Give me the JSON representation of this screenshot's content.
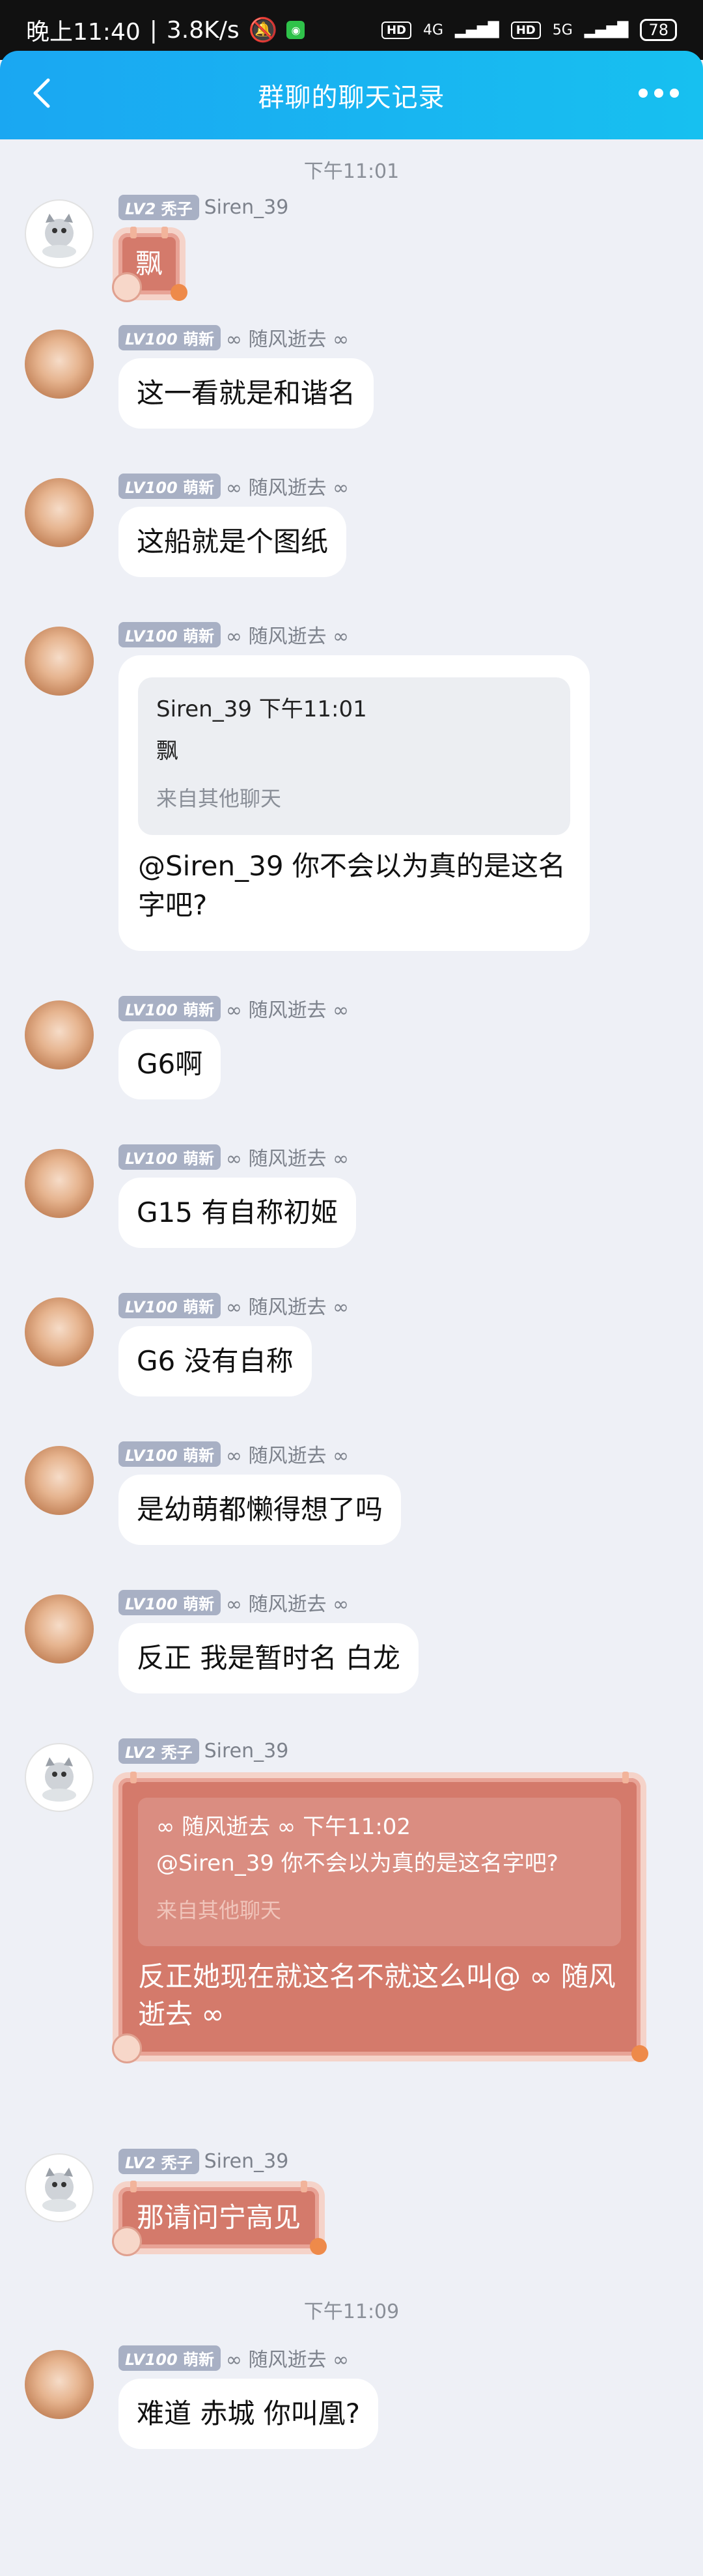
{
  "status": {
    "time": "晚上11:40",
    "speed": "3.8K/s",
    "network1": "4G",
    "network2": "5G",
    "hd": "HD",
    "battery": "78"
  },
  "appbar": {
    "title": "群聊的聊天记录"
  },
  "chat": {
    "time1": "下午11:01",
    "time2": "下午11:09",
    "lv2": "LV2",
    "lv2_title": "秃子",
    "lv100": "LV100",
    "lv100_title": "萌新",
    "nick_siren": "Siren_39",
    "nick_suifeng": "∞ 随风逝去 ∞",
    "m1": "飘",
    "m2": "这一看就是和谐名",
    "m3": "这船就是个图纸",
    "m4_quote_head": "Siren_39  下午11:01",
    "m4_quote_text": "飘",
    "m4_quote_src": "来自其他聊天",
    "m4": "@Siren_39  你不会以为真的是这名字吧?",
    "m5": "G6啊",
    "m6": "G15 有自称初姬",
    "m7": "G6 没有自称",
    "m8": "是幼萌都懒得想了吗",
    "m9": "反正 我是暂时名 白龙",
    "m10_quote_head": "∞ 随风逝去 ∞  下午11:02",
    "m10_quote_text": "@Siren_39  你不会以为真的是这名字吧?",
    "m10_quote_src": "来自其他聊天",
    "m10": "反正她现在就这名不就这么叫@ ∞ 随风逝去 ∞",
    "m11": "那请问宁高见",
    "m12": "难道 赤城 你叫凰?"
  },
  "colors": {
    "appbar": "#17b4f1",
    "background": "#eef0f6",
    "bubble": "#ffffff",
    "red_bubble": "#d47a6b",
    "level_badge": "#a8b0c4"
  },
  "icons": [
    "back-icon",
    "more-icon",
    "cat-avatar",
    "girl-avatar"
  ]
}
